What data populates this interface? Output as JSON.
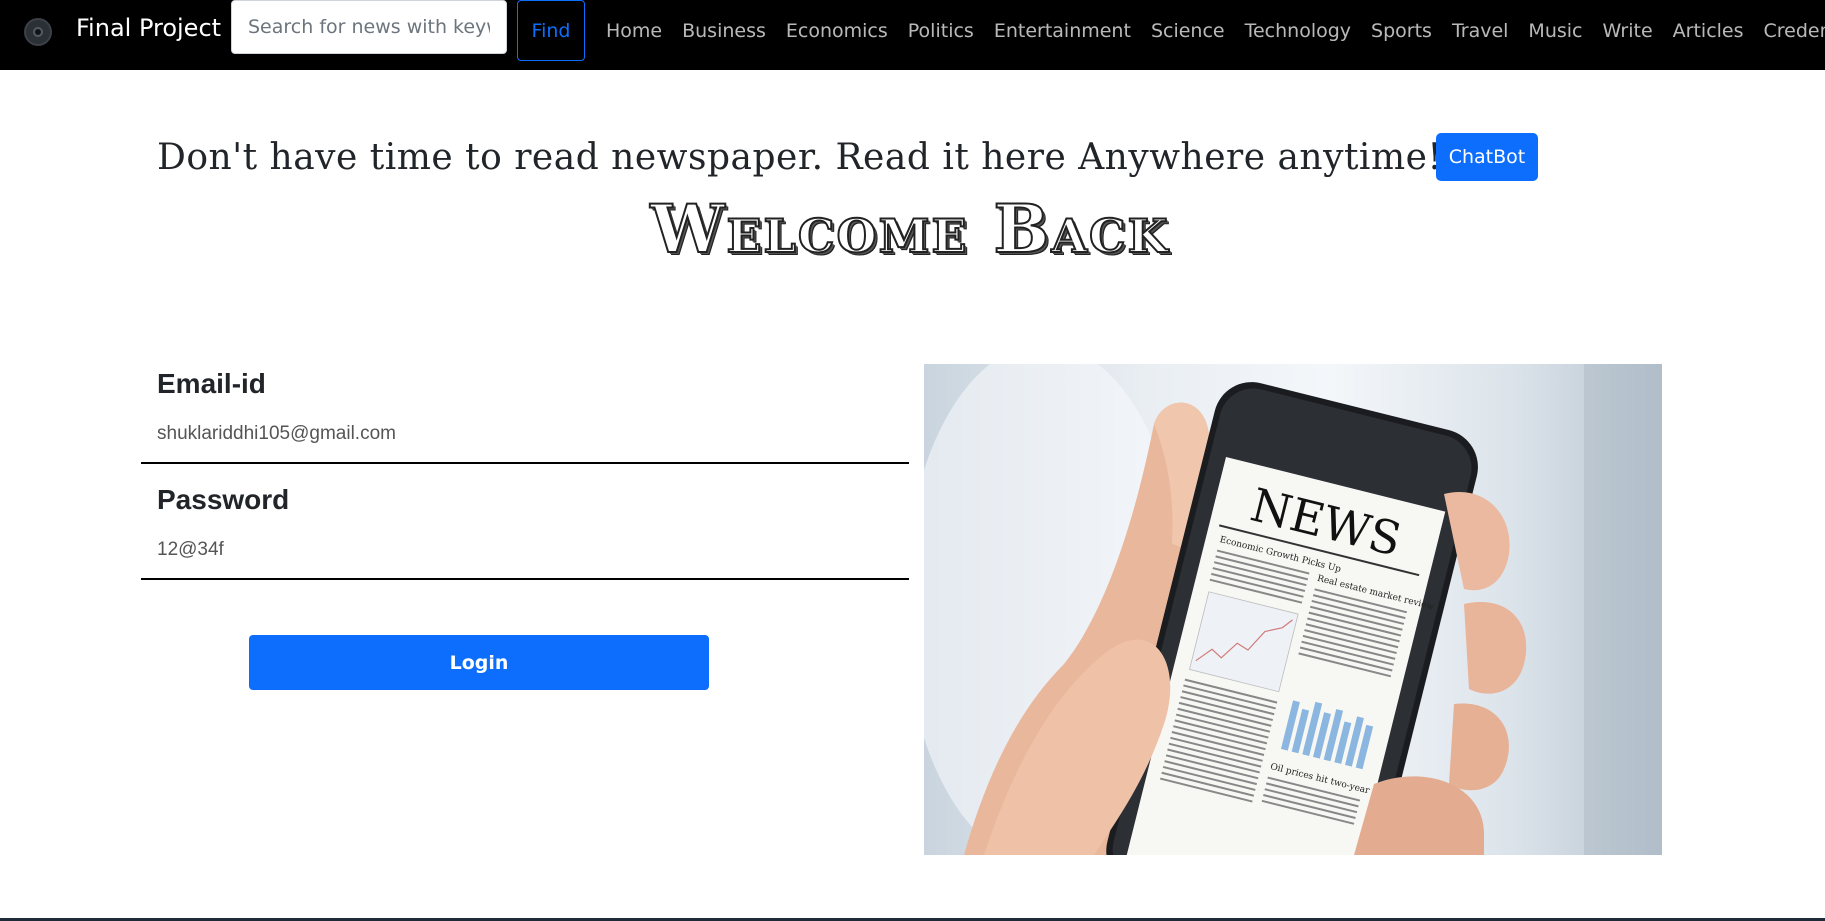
{
  "navbar": {
    "brand": "Final Project",
    "search_placeholder": "Search for news with keywords",
    "find_label": "Find",
    "links": [
      "Home",
      "Business",
      "Economics",
      "Politics",
      "Entertainment",
      "Science",
      "Technology",
      "Sports",
      "Travel",
      "Music",
      "Write",
      "Articles"
    ],
    "credentials_label": "Credentials"
  },
  "header": {
    "tagline": "Don't have time to read newspaper. Read it here Anywhere anytime!!!!",
    "chatbot_label": "ChatBot",
    "welcome": "Welcome Back"
  },
  "form": {
    "email_label": "Email-id",
    "email_value": "shuklariddhi105@gmail.com",
    "password_label": "Password",
    "password_value": "12@34f",
    "login_label": "Login"
  },
  "image": {
    "newspaper_title": "NEWS",
    "headline_1": "Economic Growth Picks Up",
    "headline_2": "Real estate market review",
    "headline_3": "Oil prices hit two-year"
  },
  "colors": {
    "navbar_bg": "#000000",
    "primary": "#0d6efd"
  }
}
